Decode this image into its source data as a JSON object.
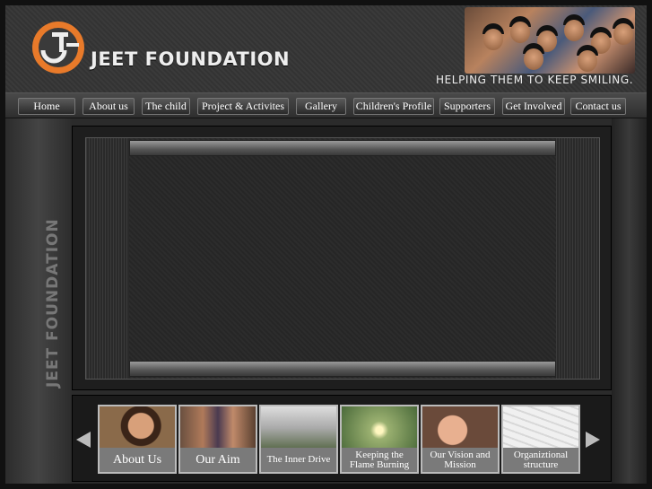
{
  "brand": {
    "name": "JEET FOUNDATION",
    "tagline": "HELPING THEM TO KEEP SMILING."
  },
  "nav": [
    {
      "label": "Home"
    },
    {
      "label": "About us"
    },
    {
      "label": "The child"
    },
    {
      "label": "Project & Activites"
    },
    {
      "label": "Gallery"
    },
    {
      "label": "Children's Profile"
    },
    {
      "label": "Supporters"
    },
    {
      "label": "Get Involved"
    },
    {
      "label": "Contact us"
    }
  ],
  "sidebar": {
    "label": "JEET FOUNDATION"
  },
  "thumbnails": [
    {
      "caption": "About Us"
    },
    {
      "caption": "Our Aim"
    },
    {
      "caption": "The Inner Drive"
    },
    {
      "caption": "Keeping the Flame Burning"
    },
    {
      "caption": "Our Vision and Mission"
    },
    {
      "caption": "Organiztional structure"
    }
  ],
  "colors": {
    "accent": "#e87a2a",
    "background": "#2b2b2b"
  },
  "icons": {
    "prev": "arrow-left-icon",
    "next": "arrow-right-icon"
  }
}
